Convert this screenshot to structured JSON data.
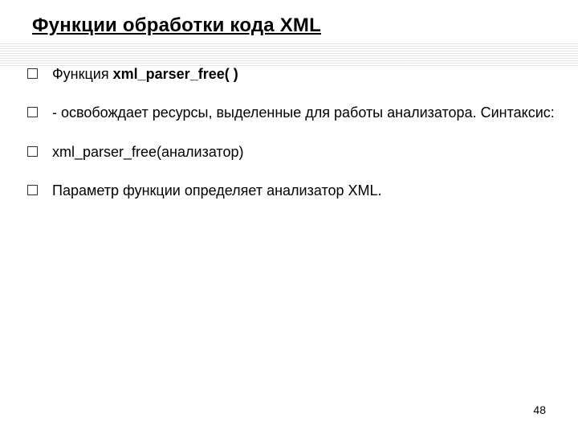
{
  "title": "Функции обработки кода XML",
  "items": [
    {
      "prefix": "Функция ",
      "bold": "xml_parser_free( )"
    },
    {
      "text": "- освобождает ресурсы, выделенные для работы анализатора. Синтаксис:"
    },
    {
      "text": "xml_parser_free(анализатор)"
    },
    {
      "text": "Параметр функции определяет анализатор XML."
    }
  ],
  "page_number": "48"
}
